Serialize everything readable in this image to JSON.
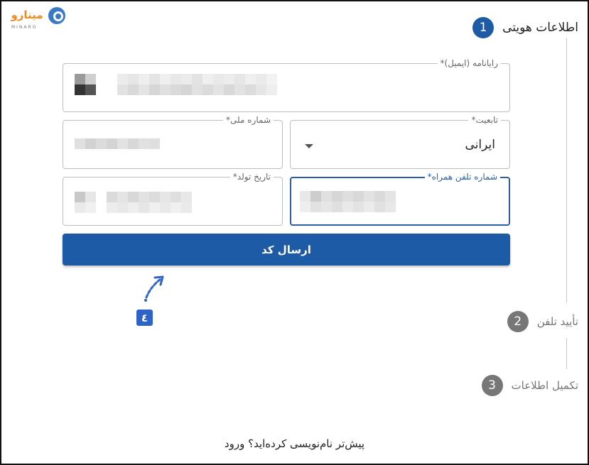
{
  "logo": {
    "word": "مینارو",
    "sub": "MINARO"
  },
  "steps": [
    {
      "num": "1",
      "label": "اطلاعات هویتی"
    },
    {
      "num": "2",
      "label": "تأیید تلفن"
    },
    {
      "num": "3",
      "label": "تکمیل اطلاعات"
    }
  ],
  "form": {
    "email_label": "رایانامه (ایمیل)*",
    "nationality_label": "تابعیت*",
    "nationality_value": "ایرانی",
    "national_id_label": "شماره ملی*",
    "phone_label": "شماره تلفن همراه*",
    "birthdate_label": "تاریخ تولد*",
    "submit_label": "ارسال کد"
  },
  "annotation": {
    "badge": "٤"
  },
  "footer": {
    "prompt": "پیش‌تر نام‌نویسی کرده‌اید؟",
    "link": "ورود"
  },
  "colors": {
    "primary": "#1e5ba6",
    "inactive": "#777777",
    "logo_orange": "#f08a1c",
    "annotation": "#2e63c7"
  }
}
